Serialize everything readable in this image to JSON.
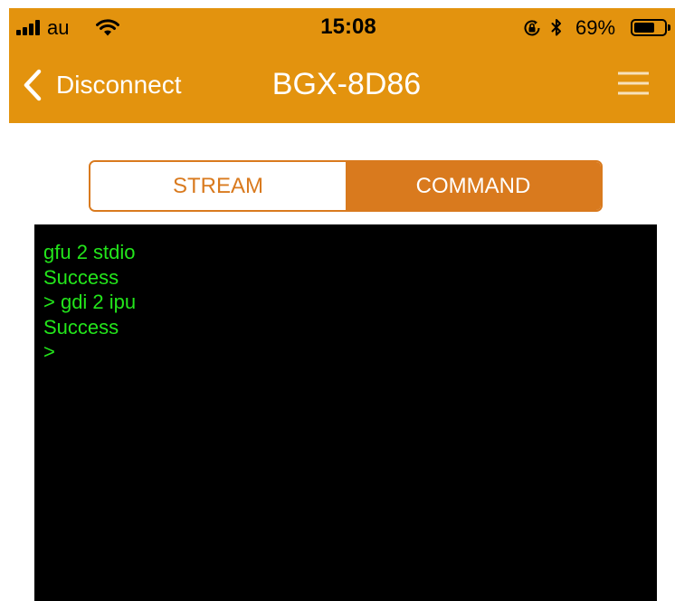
{
  "colors": {
    "header_bg": "#E3930E",
    "accent": "#D97A1E",
    "header_text": "#FFFFFF",
    "status_text": "#000000",
    "terminal_bg": "#000000",
    "terminal_text": "#23E61B"
  },
  "status_bar": {
    "carrier": "au",
    "time": "15:08",
    "battery_label": "69%",
    "battery_level": 0.69,
    "icons": [
      "signal-bars-icon",
      "wifi-icon",
      "orientation-lock-icon",
      "bluetooth-icon",
      "battery-icon"
    ]
  },
  "nav_bar": {
    "back_icon": "chevron-left-icon",
    "back_label": "Disconnect",
    "title": "BGX-8D86",
    "menu_icon": "hamburger-menu-icon"
  },
  "mode_switch": {
    "segments": [
      {
        "label": "STREAM",
        "selected": false
      },
      {
        "label": "COMMAND",
        "selected": true
      }
    ]
  },
  "terminal": {
    "lines": [
      "gfu 2 stdio",
      "Success",
      "> gdi 2 ipu",
      "Success",
      ">"
    ]
  }
}
